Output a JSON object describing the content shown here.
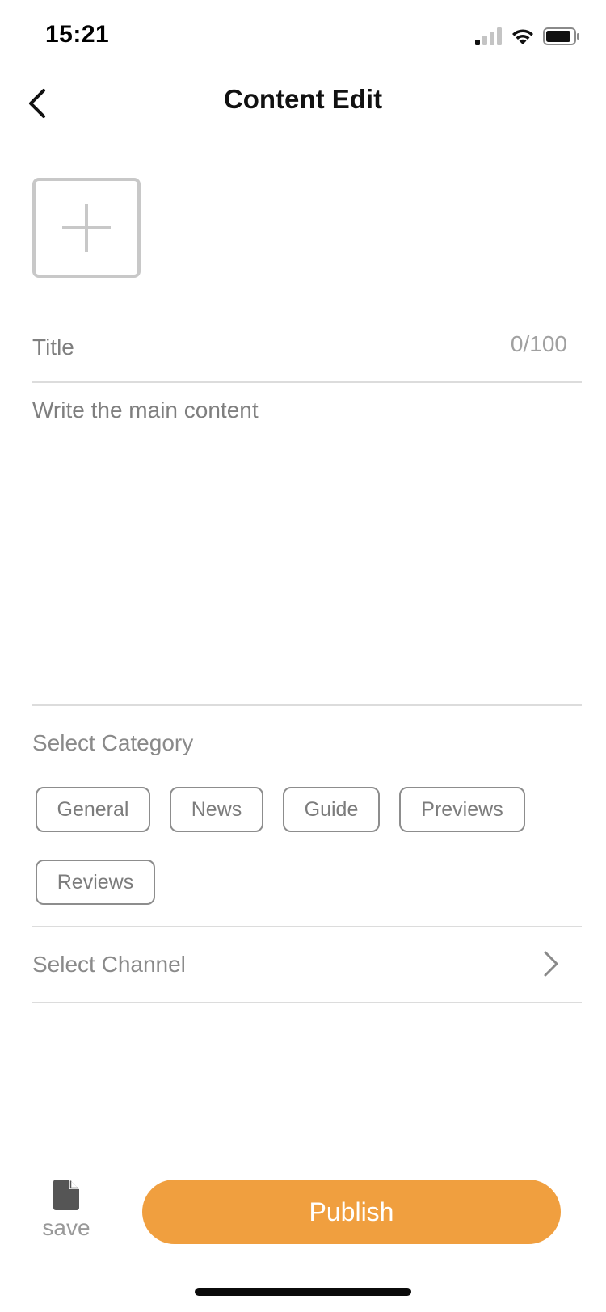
{
  "status_bar": {
    "time": "15:21",
    "icons": [
      "signal-icon",
      "wifi-icon",
      "battery-icon"
    ]
  },
  "nav": {
    "title": "Content Edit",
    "back_icon": "chevron-left-icon"
  },
  "media": {
    "add_icon": "plus-icon"
  },
  "title_field": {
    "placeholder": "Title",
    "value": "",
    "counter": "0/100"
  },
  "content_field": {
    "placeholder": "Write the main content",
    "value": ""
  },
  "category": {
    "label": "Select Category",
    "tags": [
      "General",
      "News",
      "Guide",
      "Previews",
      "Reviews"
    ]
  },
  "channel": {
    "label": "Select Channel",
    "icon": "chevron-right-icon"
  },
  "bottom_bar": {
    "save_label": "save",
    "save_icon": "document-icon",
    "publish_label": "Publish"
  },
  "colors": {
    "accent": "#f09f3f",
    "border": "#8d8d8d",
    "divider": "#dcdcdc",
    "muted_text": "#8a8a8a"
  }
}
